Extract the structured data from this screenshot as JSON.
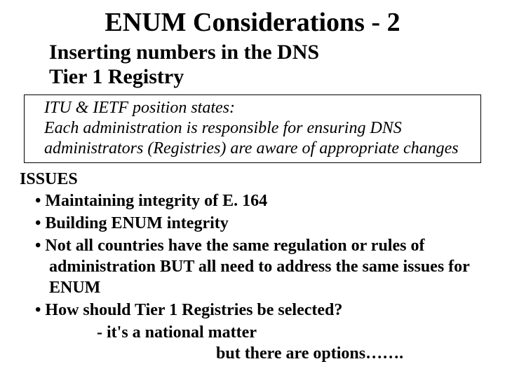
{
  "title": "ENUM Considerations - 2",
  "subtitle_line1": "Inserting numbers in the DNS",
  "subtitle_line2": "Tier 1 Registry",
  "box": {
    "line1": "ITU & IETF position states:",
    "line2": "Each administration is responsible for ensuring DNS",
    "line3": "administrators (Registries) are aware of appropriate changes"
  },
  "issues_heading": "ISSUES",
  "issues": [
    "Maintaining integrity of E. 164",
    "Building ENUM integrity",
    "Not all countries have the same regulation or rules of administration BUT all need to address the same issues for ENUM",
    "How should Tier 1 Registries be selected?"
  ],
  "indent1": "- it's a national matter",
  "indent2": "but there are options……."
}
